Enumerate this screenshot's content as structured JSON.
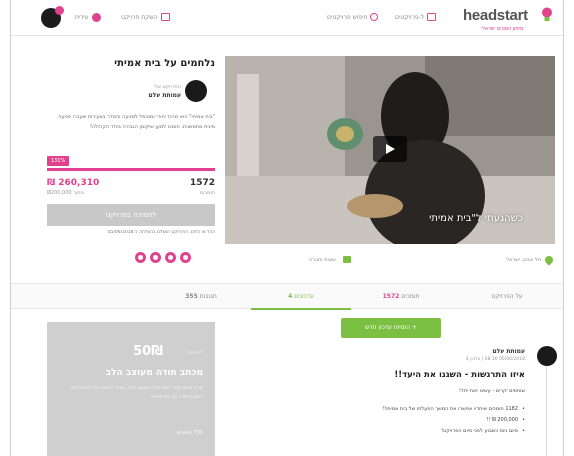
{
  "header": {
    "logo_text": "headstart",
    "logo_tagline": "מימון המונים ישראלי",
    "nav_sections": "ל-פרויקטים",
    "nav_search": "חיפוש פרויקטים",
    "nav_create": "השקת פרויקט",
    "nav_user": "עידית"
  },
  "project": {
    "title": "נלחמים על בית אמיתי",
    "owner_prefix": "הפרויקט של",
    "owner_name": "עמותת עלם",
    "description": "\"בית אמיתי\" הוא מרכז יחודי ומטופל למניעה והסדר בצעירות שעברו פגיעה מינית מתמשכת, תומכו למען שיקומן הגבירה ביחד הקהילה!",
    "percent_label": "131%",
    "percent_value": 131,
    "raised": "₪ 260,310",
    "raised_label": "מתוך ₪200,000",
    "backers": "1572",
    "backers_label": "תומכים",
    "support_button": "לתמיכה בפרויקט",
    "all_or_nothing": "הכל או כלום. הפרויקט הושלם בהצלחה ב 05/06/2018"
  },
  "video": {
    "caption": "כשהגעתי ל\"בית אמיתי"
  },
  "location_row": {
    "location": "תל אביב, ישראל",
    "category": "שונות וחברה"
  },
  "tabs": [
    {
      "label": "על הפרויקט",
      "count": ""
    },
    {
      "label": "תומכים",
      "count": "1572"
    },
    {
      "label": "עדכונים",
      "count": "4"
    },
    {
      "label": "תגובות",
      "count": "355"
    }
  ],
  "updates": {
    "add_button": "+ הוסיפו עדכון חדש",
    "author": "עמותת עלם",
    "date": "05/06/2018 08:30 | עדכון 4",
    "title": "איזו התרגשות - השגנו את היעד!!",
    "subtitle": "שותפים יקרים - עשינו זאת יחד!",
    "bullets": [
      "1182 תומכים שיחדיו אפשרו את המשך הפעלתו של בית אמיתי!!",
      "200,000 ₪ !!",
      "סיום גיוס כשבוע לפני סיום הפרויקט!"
    ]
  },
  "reward": {
    "price": "50₪",
    "min_label": "לתמיכה",
    "title": "מכתב תודה מעוצב הלב",
    "description": "יצרת איתנו קשר לתת תודה מעוצב הלב, ותוכל לצפות על בית מחלקת השמות תודה על בית אמיתי",
    "backers": "731 תומכים"
  },
  "colors": {
    "brand_pink": "#e0428d",
    "brand_green": "#7bc043"
  }
}
